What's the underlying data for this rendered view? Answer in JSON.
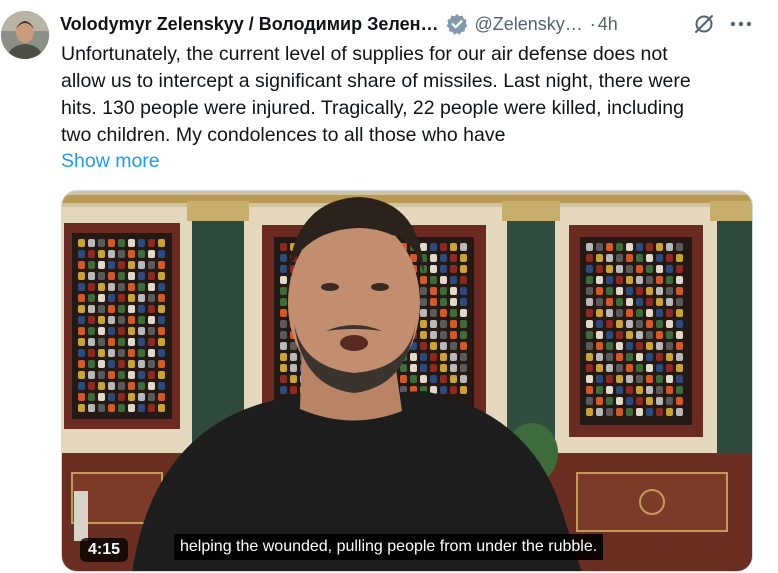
{
  "author": {
    "display_name": "Volodymyr Zelenskyy / Володимир Зелен…",
    "handle": "@Zelensky…",
    "separator": "·",
    "timestamp": "4h",
    "verified_icon": "verified-badge-icon"
  },
  "tweet": {
    "text": "Unfortunately, the current level of supplies for our air defense does not\nallow us to intercept a significant share of missiles. Last night, there were\nhits. 130 people were injured. Tragically, 22 people were killed, including\ntwo children. My condolences to all those who have",
    "show_more": "Show more"
  },
  "video": {
    "duration": "4:15",
    "caption": "helping the wounded, pulling people from under the rubble."
  },
  "colors": {
    "link": "#1d9bf0",
    "secondary_text": "#536471",
    "verified": "#829aab"
  }
}
